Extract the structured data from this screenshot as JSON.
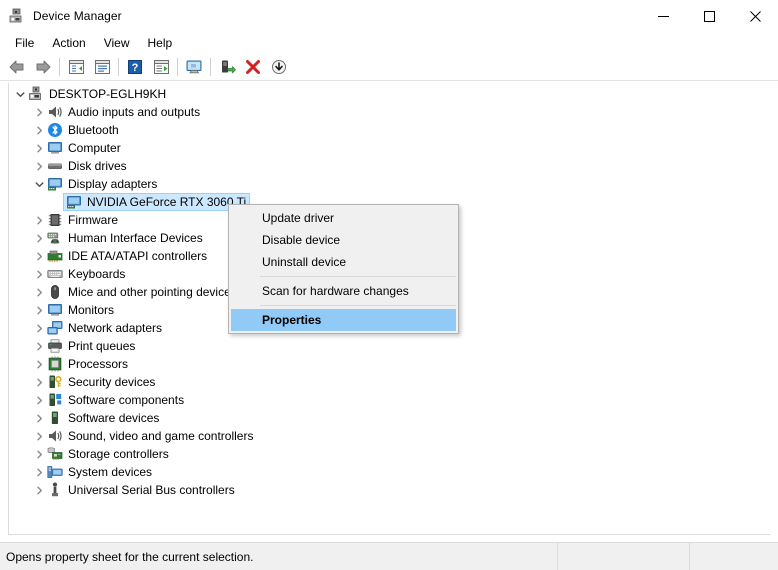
{
  "window": {
    "title": "Device Manager",
    "icon": "device-manager-icon",
    "controls": {
      "minimize": "minimize-icon",
      "maximize": "maximize-icon",
      "close": "close-icon"
    }
  },
  "menubar": {
    "items": [
      {
        "label": "File"
      },
      {
        "label": "Action"
      },
      {
        "label": "View"
      },
      {
        "label": "Help"
      }
    ]
  },
  "toolbar": {
    "buttons": [
      {
        "name": "back-icon",
        "tooltip": "Back"
      },
      {
        "name": "forward-icon",
        "tooltip": "Forward"
      },
      {
        "name": "separator-1"
      },
      {
        "name": "show-hide-console-tree-icon",
        "tooltip": "Show/Hide Console Tree"
      },
      {
        "name": "properties-icon",
        "tooltip": "Properties"
      },
      {
        "name": "separator-2"
      },
      {
        "name": "help-icon",
        "tooltip": "Help"
      },
      {
        "name": "update-driver-icon",
        "tooltip": "Update Driver Software"
      },
      {
        "name": "separator-3"
      },
      {
        "name": "scan-for-hardware-changes-icon",
        "tooltip": "Scan for hardware changes"
      },
      {
        "name": "separator-4"
      },
      {
        "name": "enable-device-icon",
        "tooltip": "Enable device"
      },
      {
        "name": "uninstall-device-icon",
        "tooltip": "Uninstall device"
      },
      {
        "name": "disable-device-icon",
        "tooltip": "Disable device"
      }
    ]
  },
  "tree": {
    "root": {
      "label": "DESKTOP-EGLH9KH",
      "icon": "computer-root-icon",
      "expanded": true
    },
    "items": [
      {
        "label": "Audio inputs and outputs",
        "icon": "speaker-icon",
        "expanded": false,
        "indent": 1
      },
      {
        "label": "Bluetooth",
        "icon": "bluetooth-icon",
        "expanded": false,
        "indent": 1
      },
      {
        "label": "Computer",
        "icon": "monitor-icon",
        "expanded": false,
        "indent": 1
      },
      {
        "label": "Disk drives",
        "icon": "disk-drive-icon",
        "expanded": false,
        "indent": 1
      },
      {
        "label": "Display adapters",
        "icon": "display-adapter-icon",
        "expanded": true,
        "indent": 1
      },
      {
        "label": "NVIDIA GeForce RTX 3060 Ti",
        "icon": "display-adapter-icon",
        "leaf": true,
        "selected": true,
        "indent": 2
      },
      {
        "label": "Firmware",
        "icon": "firmware-chip-icon",
        "expanded": false,
        "indent": 1
      },
      {
        "label": "Human Interface Devices",
        "icon": "hid-icon",
        "expanded": false,
        "indent": 1
      },
      {
        "label": "IDE ATA/ATAPI controllers",
        "icon": "ide-controller-icon",
        "expanded": false,
        "indent": 1
      },
      {
        "label": "Keyboards",
        "icon": "keyboard-icon",
        "expanded": false,
        "indent": 1
      },
      {
        "label": "Mice and other pointing device",
        "icon": "mouse-icon",
        "expanded": false,
        "indent": 1
      },
      {
        "label": "Monitors",
        "icon": "monitor-icon",
        "expanded": false,
        "indent": 1
      },
      {
        "label": "Network adapters",
        "icon": "network-adapter-icon",
        "expanded": false,
        "indent": 1
      },
      {
        "label": "Print queues",
        "icon": "printer-icon",
        "expanded": false,
        "indent": 1
      },
      {
        "label": "Processors",
        "icon": "processor-icon",
        "expanded": false,
        "indent": 1
      },
      {
        "label": "Security devices",
        "icon": "security-device-icon",
        "expanded": false,
        "indent": 1
      },
      {
        "label": "Software components",
        "icon": "software-component-icon",
        "expanded": false,
        "indent": 1
      },
      {
        "label": "Software devices",
        "icon": "software-device-icon",
        "expanded": false,
        "indent": 1
      },
      {
        "label": "Sound, video and game controllers",
        "icon": "speaker-icon",
        "expanded": false,
        "indent": 1
      },
      {
        "label": "Storage controllers",
        "icon": "storage-controller-icon",
        "expanded": false,
        "indent": 1
      },
      {
        "label": "System devices",
        "icon": "system-device-icon",
        "expanded": false,
        "indent": 1
      },
      {
        "label": "Universal Serial Bus controllers",
        "icon": "usb-icon",
        "expanded": false,
        "indent": 1
      }
    ]
  },
  "context_menu": {
    "items": [
      {
        "label": "Update driver",
        "type": "item",
        "highlighted": false
      },
      {
        "label": "Disable device",
        "type": "item",
        "highlighted": false
      },
      {
        "label": "Uninstall device",
        "type": "item",
        "highlighted": false
      },
      {
        "type": "separator"
      },
      {
        "label": "Scan for hardware changes",
        "type": "item",
        "highlighted": false
      },
      {
        "type": "separator"
      },
      {
        "label": "Properties",
        "type": "item",
        "highlighted": true
      }
    ]
  },
  "statusbar": {
    "message": "Opens property sheet for the current selection.",
    "pane2": "",
    "pane3": ""
  },
  "colors": {
    "selection_fill": "#cce8ff",
    "selection_border": "#99d1ff",
    "menu_highlight": "#91c9f7",
    "menu_background": "#f0f0f0",
    "window_background": "#ffffff",
    "status_background": "#f0f0f0"
  }
}
